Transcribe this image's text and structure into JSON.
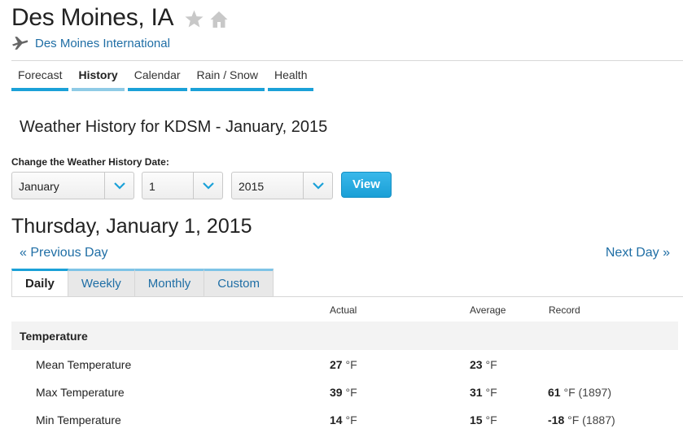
{
  "header": {
    "city": "Des Moines, IA",
    "airport": "Des Moines International"
  },
  "nav": [
    {
      "label": "Forecast"
    },
    {
      "label": "History"
    },
    {
      "label": "Calendar"
    },
    {
      "label": "Rain / Snow"
    },
    {
      "label": "Health"
    }
  ],
  "history_heading": "Weather History for KDSM - January, 2015",
  "date_form": {
    "label": "Change the Weather History Date:",
    "month": "January",
    "day": "1",
    "year": "2015",
    "view_label": "View"
  },
  "date_heading": "Thursday, January 1, 2015",
  "pager": {
    "prev": "« Previous Day",
    "next": "Next Day »"
  },
  "tabs": [
    {
      "label": "Daily"
    },
    {
      "label": "Weekly"
    },
    {
      "label": "Monthly"
    },
    {
      "label": "Custom"
    }
  ],
  "table": {
    "columns": {
      "actual": "Actual",
      "average": "Average",
      "record": "Record"
    },
    "section": "Temperature",
    "unit": "°F",
    "rows": [
      {
        "label": "Mean Temperature",
        "actual": "27",
        "average": "23",
        "record": "",
        "record_year": ""
      },
      {
        "label": "Max Temperature",
        "actual": "39",
        "average": "31",
        "record": "61",
        "record_year": "(1897)"
      },
      {
        "label": "Min Temperature",
        "actual": "14",
        "average": "15",
        "record": "-18",
        "record_year": "(1887)"
      }
    ]
  },
  "colors": {
    "accent": "#1ba1d8",
    "link": "#1f6ea5",
    "icon_gray": "#c8c8c8"
  }
}
